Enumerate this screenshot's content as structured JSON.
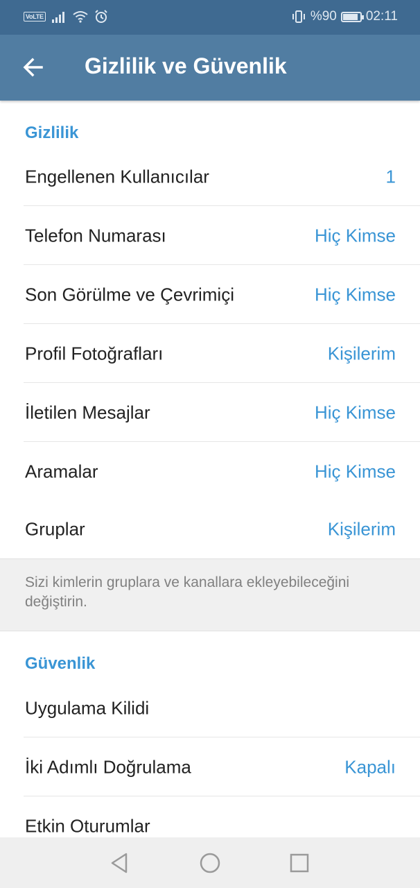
{
  "status_bar": {
    "volte": "VoLTE",
    "battery_text": "%90",
    "battery_level": 0.9,
    "time": "02:11"
  },
  "app_bar": {
    "title": "Gizlilik ve Güvenlik"
  },
  "privacy": {
    "header": "Gizlilik",
    "items": [
      {
        "label": "Engellenen Kullanıcılar",
        "value": "1"
      },
      {
        "label": "Telefon Numarası",
        "value": "Hiç Kimse"
      },
      {
        "label": "Son Görülme ve Çevrimiçi",
        "value": "Hiç Kimse"
      },
      {
        "label": "Profil Fotoğrafları",
        "value": "Kişilerim"
      },
      {
        "label": "İletilen Mesajlar",
        "value": "Hiç Kimse"
      },
      {
        "label": "Aramalar",
        "value": "Hiç Kimse"
      },
      {
        "label": "Gruplar",
        "value": "Kişilerim"
      }
    ],
    "info": "Sizi kimlerin gruplara ve kanallara ekleyebileceğini değiştirin."
  },
  "security": {
    "header": "Güvenlik",
    "items": [
      {
        "label": "Uygulama Kilidi",
        "value": ""
      },
      {
        "label": "İki Adımlı Doğrulama",
        "value": "Kapalı"
      },
      {
        "label": "Etkin Oturumlar",
        "value": ""
      }
    ]
  },
  "icons": {
    "back": "arrow-left-icon",
    "nav": [
      "back-triangle-icon",
      "home-circle-icon",
      "recents-square-icon"
    ]
  },
  "colors": {
    "app_bar": "#517da2",
    "status_bar": "#3f6a91",
    "accent": "#3a95d5"
  }
}
